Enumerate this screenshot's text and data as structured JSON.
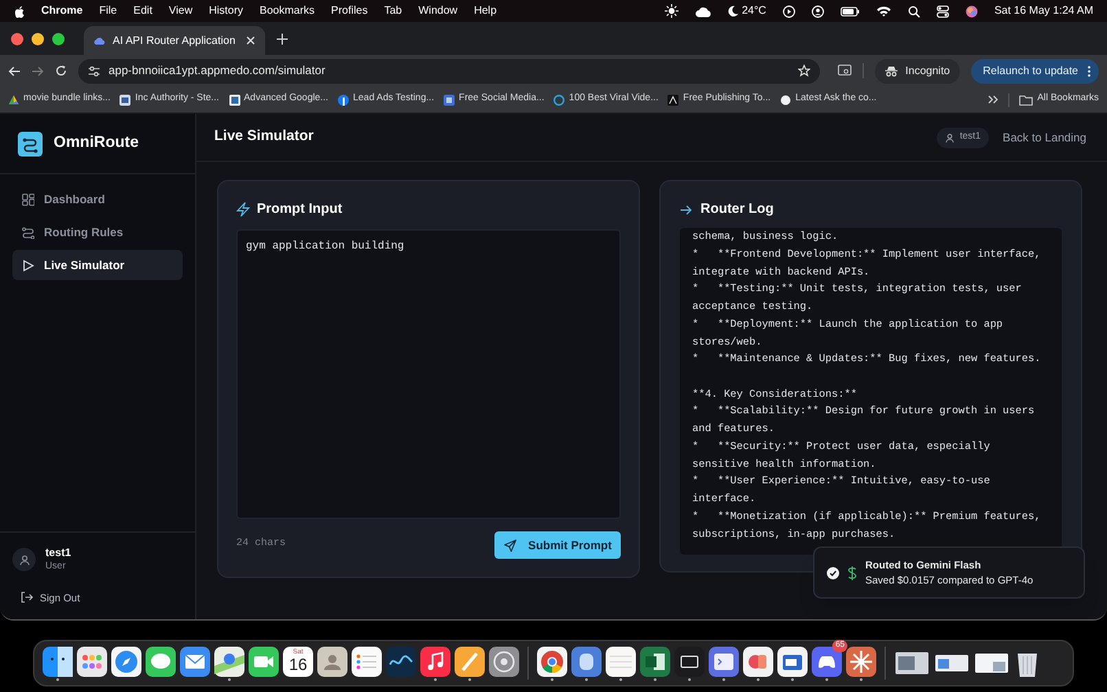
{
  "menu_bar": {
    "app": "Chrome",
    "menus": [
      "File",
      "Edit",
      "View",
      "History",
      "Bookmarks",
      "Profiles",
      "Tab",
      "Window",
      "Help"
    ],
    "weather": "24°C",
    "clock": "Sat 16 May  1:24 AM"
  },
  "browser": {
    "tabs": [
      {
        "title": "AI API Router Application",
        "selected": true
      }
    ],
    "url": "app-bnnoiica1ypt.appmedo.com/simulator",
    "incognito": "Incognito",
    "relaunch": "Relaunch to update",
    "bookmarks": [
      "movie bundle links...",
      "Inc Authority - Ste...",
      "Advanced Google...",
      "Lead Ads Testing...",
      "Free Social Media...",
      "100 Best Viral Vide...",
      "Free Publishing To...",
      "Latest Ask the co..."
    ],
    "all_bookmarks": "All Bookmarks"
  },
  "app": {
    "brand": "OmniRoute",
    "nav": [
      {
        "label": "Dashboard",
        "selected": false,
        "kind": "grid"
      },
      {
        "label": "Routing Rules",
        "selected": false,
        "kind": "route"
      },
      {
        "label": "Live Simulator",
        "selected": true,
        "kind": "play"
      }
    ],
    "user": {
      "name": "test1",
      "role": "User"
    },
    "sign_out": "Sign Out",
    "page_title": "Live Simulator",
    "user_chip": "test1",
    "back_link": "Back to Landing",
    "prompt": {
      "title": "Prompt Input",
      "value": "gym application building",
      "count": "24 chars",
      "submit": "Submit Prompt"
    },
    "router_log": {
      "title": "Router Log",
      "blocks": [
        [
          "schema, business logic.",
          "*   **Frontend Development:** Implement user interface,",
          "integrate with backend APIs.",
          "*   **Testing:** Unit tests, integration tests, user",
          "acceptance testing.",
          "*   **Deployment:** Launch the application to app",
          "stores/web.",
          "*   **Maintenance & Updates:** Bug fixes, new features."
        ],
        [
          "**4. Key Considerations:**",
          "*   **Scalability:** Design for future growth in users",
          "and features.",
          "*   **Security:** Protect user data, especially",
          "sensitive health information.",
          "*   **User Experience:** Intuitive, easy-to-use",
          "interface.",
          "*   **Monetization (if applicable):** Premium features,",
          "subscriptions, in-app purchases."
        ]
      ]
    },
    "toast": {
      "title": "Routed to Gemini Flash",
      "message": "Saved $0.0157 compared to GPT-4o"
    }
  },
  "dock": {
    "calendar_day": "Sat",
    "calendar_date": "16",
    "badge": "65"
  }
}
